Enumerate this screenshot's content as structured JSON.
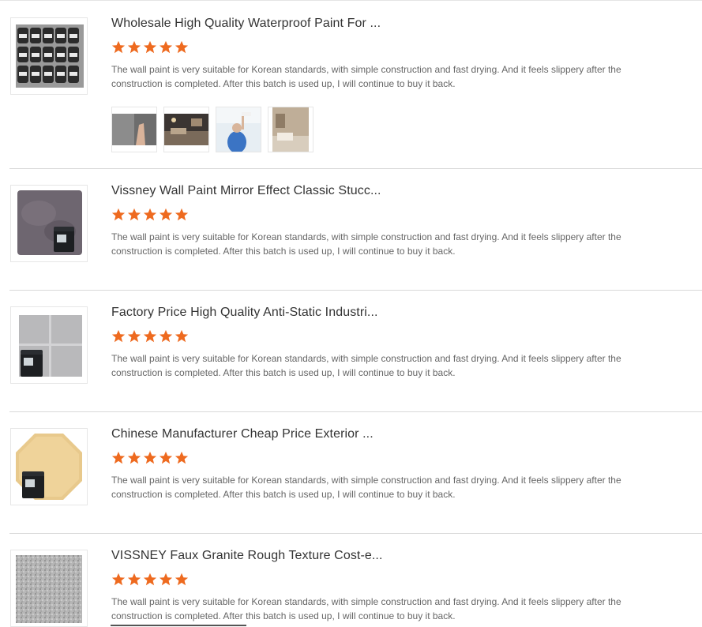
{
  "reviews": [
    {
      "title": "Wholesale High Quality Waterproof Paint For ...",
      "rating": 5,
      "text": "The wall paint is very suitable for Korean standards, with simple construction and fast drying. And it feels slippery after the construction is completed. After this batch is used up, I will continue to buy it back.",
      "image": "paint-buckets-stack-image",
      "gallery": [
        "wall-paint-hand-image",
        "living-room-image",
        "painter-roller-image",
        "interior-room-image"
      ]
    },
    {
      "title": "Vissney Wall Paint Mirror Effect Classic Stucc...",
      "rating": 5,
      "text": "The wall paint is very suitable for Korean standards, with simple construction and fast drying. And it feels slippery after the construction is completed. After this batch is used up, I will continue to buy it back.",
      "image": "stucco-swatch-bucket-image"
    },
    {
      "title": "Factory Price High Quality Anti-Static Industri...",
      "rating": 5,
      "text": "The wall paint is very suitable for Korean standards, with simple construction and fast drying. And it feels slippery after the construction is completed. After this batch is used up, I will continue to buy it back.",
      "image": "grey-tile-swatch-bucket-image"
    },
    {
      "title": "Chinese Manufacturer Cheap Price Exterior ...",
      "rating": 5,
      "text": "The wall paint is very suitable for Korean standards, with simple construction and fast drying. And it feels slippery after the construction is completed. After this batch is used up, I will continue to buy it back.",
      "image": "beige-octagon-swatch-bucket-image"
    },
    {
      "title": "VISSNEY Faux Granite Rough Texture Cost-e...",
      "rating": 5,
      "text": "The wall paint is very suitable for Korean standards, with simple construction and fast drying. And it feels slippery after the construction is completed. After this batch is used up, I will continue to buy it back.",
      "image": "granite-texture-swatch-image"
    }
  ],
  "colors": {
    "star": "#ee6a1f",
    "divider": "#d9d9d9",
    "title": "#333333",
    "body": "#666666"
  }
}
